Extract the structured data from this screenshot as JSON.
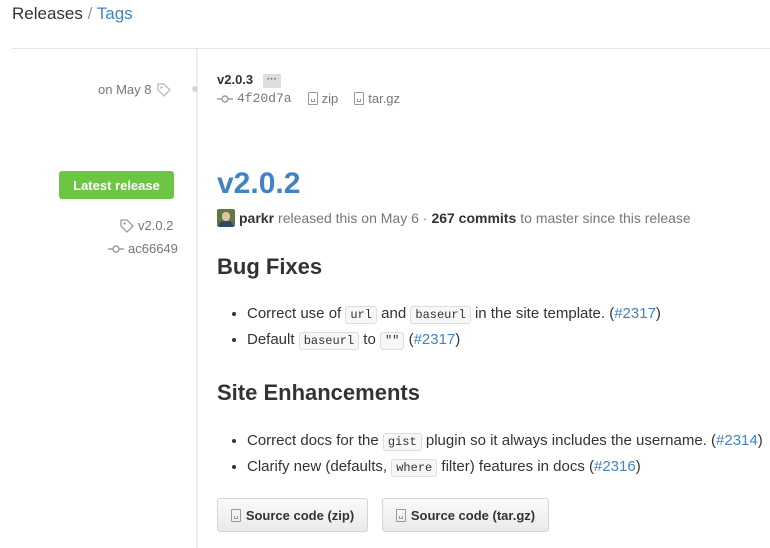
{
  "header": {
    "releases": "Releases",
    "separator": "/",
    "tags": "Tags"
  },
  "older_release": {
    "date": "on May 8",
    "version": "v2.0.3",
    "more": "···",
    "commit": "4f20d7a",
    "zip": "zip",
    "targz": "tar.gz"
  },
  "latest_release": {
    "badge": "Latest release",
    "tag": "v2.0.2",
    "commit": "ac66649",
    "title": "v2.0.2",
    "author": "parkr",
    "released_text": "released this on May 6 ·",
    "commits": "267 commits",
    "since_text": "to master since this release",
    "sections": [
      {
        "heading": "Bug Fixes",
        "items": [
          {
            "pre": "Correct use of",
            "code1": "url",
            "mid": "and",
            "code2": "baseurl",
            "post": "in the site template. (",
            "link": "#2317",
            "end": ")"
          },
          {
            "pre": "Default",
            "code1": "baseurl",
            "mid": "to",
            "code2": "\"\"",
            "post": "(",
            "link": "#2317",
            "end": ")"
          }
        ]
      },
      {
        "heading": "Site Enhancements",
        "items": [
          {
            "pre": "Correct docs for the",
            "code1": "gist",
            "post": "plugin so it always includes the username. (",
            "link": "#2314",
            "end": ")"
          },
          {
            "pre": "Clarify new (defaults,",
            "code1": "where",
            "post": "filter) features in docs (",
            "link": "#2316",
            "end": ")"
          }
        ]
      }
    ],
    "source_zip": "Source code (zip)",
    "source_targz": "Source code (tar.gz)"
  },
  "colors": {
    "link": "#4183c4",
    "badge": "#6cc644",
    "muted": "#777777"
  }
}
